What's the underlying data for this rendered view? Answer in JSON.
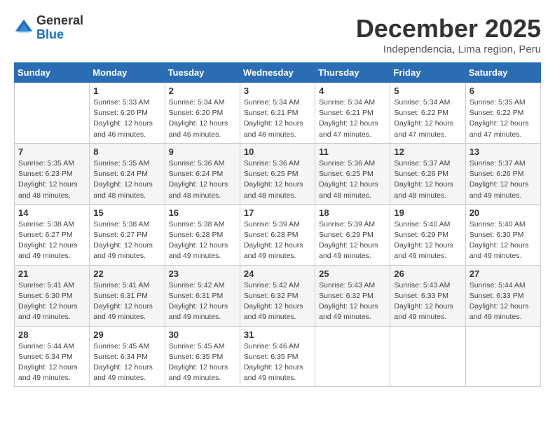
{
  "logo": {
    "general": "General",
    "blue": "Blue"
  },
  "title": "December 2025",
  "location": "Independencia, Lima region, Peru",
  "days_of_week": [
    "Sunday",
    "Monday",
    "Tuesday",
    "Wednesday",
    "Thursday",
    "Friday",
    "Saturday"
  ],
  "weeks": [
    [
      {
        "day": "",
        "info": ""
      },
      {
        "day": "1",
        "info": "Sunrise: 5:33 AM\nSunset: 6:20 PM\nDaylight: 12 hours and 46 minutes."
      },
      {
        "day": "2",
        "info": "Sunrise: 5:34 AM\nSunset: 6:20 PM\nDaylight: 12 hours and 46 minutes."
      },
      {
        "day": "3",
        "info": "Sunrise: 5:34 AM\nSunset: 6:21 PM\nDaylight: 12 hours and 46 minutes."
      },
      {
        "day": "4",
        "info": "Sunrise: 5:34 AM\nSunset: 6:21 PM\nDaylight: 12 hours and 47 minutes."
      },
      {
        "day": "5",
        "info": "Sunrise: 5:34 AM\nSunset: 6:22 PM\nDaylight: 12 hours and 47 minutes."
      },
      {
        "day": "6",
        "info": "Sunrise: 5:35 AM\nSunset: 6:22 PM\nDaylight: 12 hours and 47 minutes."
      }
    ],
    [
      {
        "day": "7",
        "info": "Sunrise: 5:35 AM\nSunset: 6:23 PM\nDaylight: 12 hours and 48 minutes."
      },
      {
        "day": "8",
        "info": "Sunrise: 5:35 AM\nSunset: 6:24 PM\nDaylight: 12 hours and 48 minutes."
      },
      {
        "day": "9",
        "info": "Sunrise: 5:36 AM\nSunset: 6:24 PM\nDaylight: 12 hours and 48 minutes."
      },
      {
        "day": "10",
        "info": "Sunrise: 5:36 AM\nSunset: 6:25 PM\nDaylight: 12 hours and 48 minutes."
      },
      {
        "day": "11",
        "info": "Sunrise: 5:36 AM\nSunset: 6:25 PM\nDaylight: 12 hours and 48 minutes."
      },
      {
        "day": "12",
        "info": "Sunrise: 5:37 AM\nSunset: 6:26 PM\nDaylight: 12 hours and 48 minutes."
      },
      {
        "day": "13",
        "info": "Sunrise: 5:37 AM\nSunset: 6:26 PM\nDaylight: 12 hours and 49 minutes."
      }
    ],
    [
      {
        "day": "14",
        "info": "Sunrise: 5:38 AM\nSunset: 6:27 PM\nDaylight: 12 hours and 49 minutes."
      },
      {
        "day": "15",
        "info": "Sunrise: 5:38 AM\nSunset: 6:27 PM\nDaylight: 12 hours and 49 minutes."
      },
      {
        "day": "16",
        "info": "Sunrise: 5:38 AM\nSunset: 6:28 PM\nDaylight: 12 hours and 49 minutes."
      },
      {
        "day": "17",
        "info": "Sunrise: 5:39 AM\nSunset: 6:28 PM\nDaylight: 12 hours and 49 minutes."
      },
      {
        "day": "18",
        "info": "Sunrise: 5:39 AM\nSunset: 6:29 PM\nDaylight: 12 hours and 49 minutes."
      },
      {
        "day": "19",
        "info": "Sunrise: 5:40 AM\nSunset: 6:29 PM\nDaylight: 12 hours and 49 minutes."
      },
      {
        "day": "20",
        "info": "Sunrise: 5:40 AM\nSunset: 6:30 PM\nDaylight: 12 hours and 49 minutes."
      }
    ],
    [
      {
        "day": "21",
        "info": "Sunrise: 5:41 AM\nSunset: 6:30 PM\nDaylight: 12 hours and 49 minutes."
      },
      {
        "day": "22",
        "info": "Sunrise: 5:41 AM\nSunset: 6:31 PM\nDaylight: 12 hours and 49 minutes."
      },
      {
        "day": "23",
        "info": "Sunrise: 5:42 AM\nSunset: 6:31 PM\nDaylight: 12 hours and 49 minutes."
      },
      {
        "day": "24",
        "info": "Sunrise: 5:42 AM\nSunset: 6:32 PM\nDaylight: 12 hours and 49 minutes."
      },
      {
        "day": "25",
        "info": "Sunrise: 5:43 AM\nSunset: 6:32 PM\nDaylight: 12 hours and 49 minutes."
      },
      {
        "day": "26",
        "info": "Sunrise: 5:43 AM\nSunset: 6:33 PM\nDaylight: 12 hours and 49 minutes."
      },
      {
        "day": "27",
        "info": "Sunrise: 5:44 AM\nSunset: 6:33 PM\nDaylight: 12 hours and 49 minutes."
      }
    ],
    [
      {
        "day": "28",
        "info": "Sunrise: 5:44 AM\nSunset: 6:34 PM\nDaylight: 12 hours and 49 minutes."
      },
      {
        "day": "29",
        "info": "Sunrise: 5:45 AM\nSunset: 6:34 PM\nDaylight: 12 hours and 49 minutes."
      },
      {
        "day": "30",
        "info": "Sunrise: 5:45 AM\nSunset: 6:35 PM\nDaylight: 12 hours and 49 minutes."
      },
      {
        "day": "31",
        "info": "Sunrise: 5:46 AM\nSunset: 6:35 PM\nDaylight: 12 hours and 49 minutes."
      },
      {
        "day": "",
        "info": ""
      },
      {
        "day": "",
        "info": ""
      },
      {
        "day": "",
        "info": ""
      }
    ]
  ]
}
